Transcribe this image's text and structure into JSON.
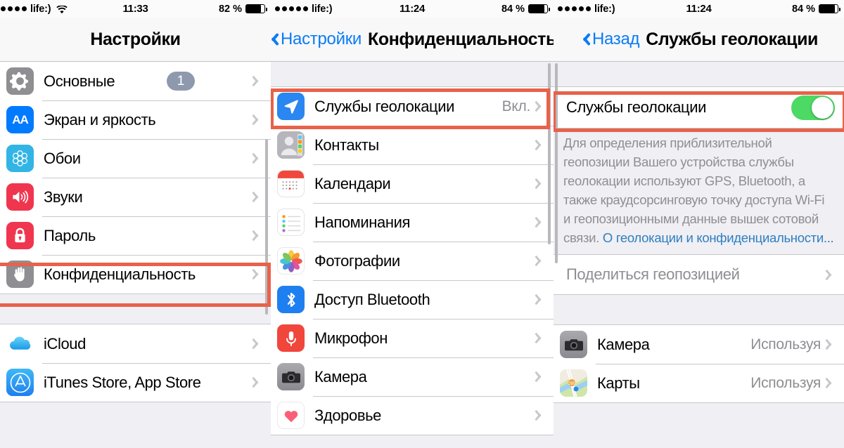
{
  "panels": [
    {
      "id": "settings",
      "status": {
        "carrier": "life:)",
        "dots": 4,
        "wifi": true,
        "time": "11:33",
        "battery_text": "82 %",
        "battery_level": 82
      },
      "nav": {
        "back": null,
        "title": "Настройки"
      },
      "groups": [
        {
          "rows": [
            {
              "icon": "gear-icon",
              "label": "Основные",
              "badge": "1",
              "chevron": true
            },
            {
              "icon": "display-brightness-icon",
              "label": "Экран и яркость",
              "chevron": true
            },
            {
              "icon": "wallpaper-icon",
              "label": "Обои",
              "chevron": true
            },
            {
              "icon": "sounds-icon",
              "label": "Звуки",
              "chevron": true
            },
            {
              "icon": "lock-icon",
              "label": "Пароль",
              "chevron": true
            },
            {
              "icon": "privacy-hand-icon",
              "label": "Конфиденциальность",
              "chevron": true,
              "highlight": true
            }
          ]
        },
        {
          "rows": [
            {
              "icon": "icloud-icon",
              "label": "iCloud",
              "chevron": true
            },
            {
              "icon": "app-store-icon",
              "label": "iTunes Store, App Store",
              "chevron": true
            }
          ]
        }
      ]
    },
    {
      "id": "privacy",
      "status": {
        "carrier": "life:)",
        "dots": 5,
        "wifi": false,
        "time": "11:24",
        "battery_text": "84 %",
        "battery_level": 84
      },
      "nav": {
        "back": "Настройки",
        "title": "Конфиденциальность"
      },
      "groups": [
        {
          "rows": [
            {
              "icon": "location-arrow-icon",
              "label": "Службы геолокации",
              "value": "Вкл.",
              "chevron": true,
              "highlight": true
            },
            {
              "icon": "contacts-icon",
              "label": "Контакты",
              "chevron": true
            },
            {
              "icon": "calendar-icon",
              "label": "Календари",
              "chevron": true
            },
            {
              "icon": "reminders-icon",
              "label": "Напоминания",
              "chevron": true
            },
            {
              "icon": "photos-icon",
              "label": "Фотографии",
              "chevron": true
            },
            {
              "icon": "bluetooth-icon",
              "label": "Доступ Bluetooth",
              "chevron": true
            },
            {
              "icon": "microphone-icon",
              "label": "Микрофон",
              "chevron": true
            },
            {
              "icon": "camera-icon",
              "label": "Камера",
              "chevron": true
            },
            {
              "icon": "health-heart-icon",
              "label": "Здоровье",
              "chevron": true
            }
          ]
        }
      ]
    },
    {
      "id": "location-services",
      "status": {
        "carrier": "life:)",
        "dots": 5,
        "wifi": false,
        "time": "11:24",
        "battery_text": "84 %",
        "battery_level": 84
      },
      "nav": {
        "back": "Назад",
        "title": "Службы геолокации"
      },
      "toggle_row": {
        "label": "Службы геолокации",
        "toggle_on": true,
        "highlight": true
      },
      "description": {
        "text": "Для определения приблизительной геопозиции Вашего устройства службы геолокации используют GPS, Bluetooth, а также краудсорсинговую точку доступа Wi-Fi и геопозиционными данные вышек сотовой связи.",
        "link": "О геолокации и конфиденциальности..."
      },
      "share_row": {
        "label": "Поделиться геопозицией",
        "chevron": true
      },
      "app_rows": [
        {
          "icon": "camera-icon",
          "label": "Камера",
          "value": "Используя",
          "chevron": true
        },
        {
          "icon": "maps-icon",
          "label": "Карты",
          "value": "Используя",
          "chevron": true
        }
      ]
    }
  ],
  "colors": {
    "highlight": "#e8624a",
    "tint": "#0a7cf6",
    "toggle_on": "#4cd964",
    "group_bg": "#efeff4",
    "muted_text": "#8e8e93"
  }
}
